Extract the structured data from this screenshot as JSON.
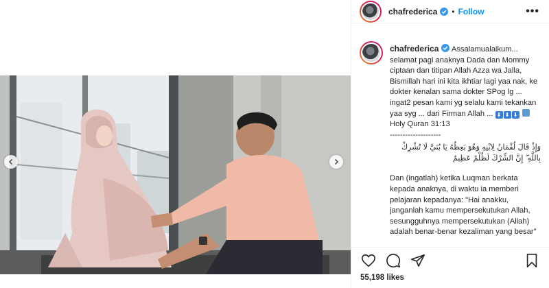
{
  "post": {
    "username": "chafrederica",
    "separator": "•",
    "follow_label": "Follow",
    "more_label": "•••"
  },
  "caption": {
    "username": "chafrederica",
    "lines_main": "Assalamualaikum... selamat pagi anaknya Dada dan Mommy ciptaan dan titipan Allah Azza wa Jalla, Bismillah hari ini kita ikhtiar lagi yaa nak, ke dokter kenalan sama dokter SPog lg ... ingat2 pesan kami yg selalu kami tekankan yaa syg ... dari Firman Allah ...",
    "emoji_arrows": [
      "⬇",
      "⬇",
      "⬇"
    ],
    "quran_ref": "Holy Quran 31:13",
    "divider": "--------------------",
    "arabic": "وَإِذْ قَالَ لُقْمَانُ لِابْنِهِ وَهُوَ يَعِظُهُ يَا بُنَيَّ لَا تُشْرِكْ بِاللَّهِ ۖ إِنَّ الشِّرْكَ لَظُلْمٌ عَظِيمٌ",
    "translation": "Dan (ingatlah) ketika Luqman berkata kepada anaknya, di waktu ia memberi pelajaran kepadanya: \"Hai anakku, janganlah kamu mempersekutukan Allah, sesungguhnya mempersekutukan (Allah) adalah benar-benar kezaliman yang besar\""
  },
  "engagement": {
    "likes": "55,198 likes"
  },
  "icons": {
    "verified": "verified-badge-icon",
    "like": "heart-icon",
    "comment": "comment-bubble-icon",
    "share": "paper-plane-icon",
    "save": "bookmark-icon",
    "prev": "chevron-left-icon",
    "next": "chevron-right-icon"
  },
  "colors": {
    "link_blue": "#0095f6",
    "text": "#262626",
    "border": "#efefef"
  }
}
